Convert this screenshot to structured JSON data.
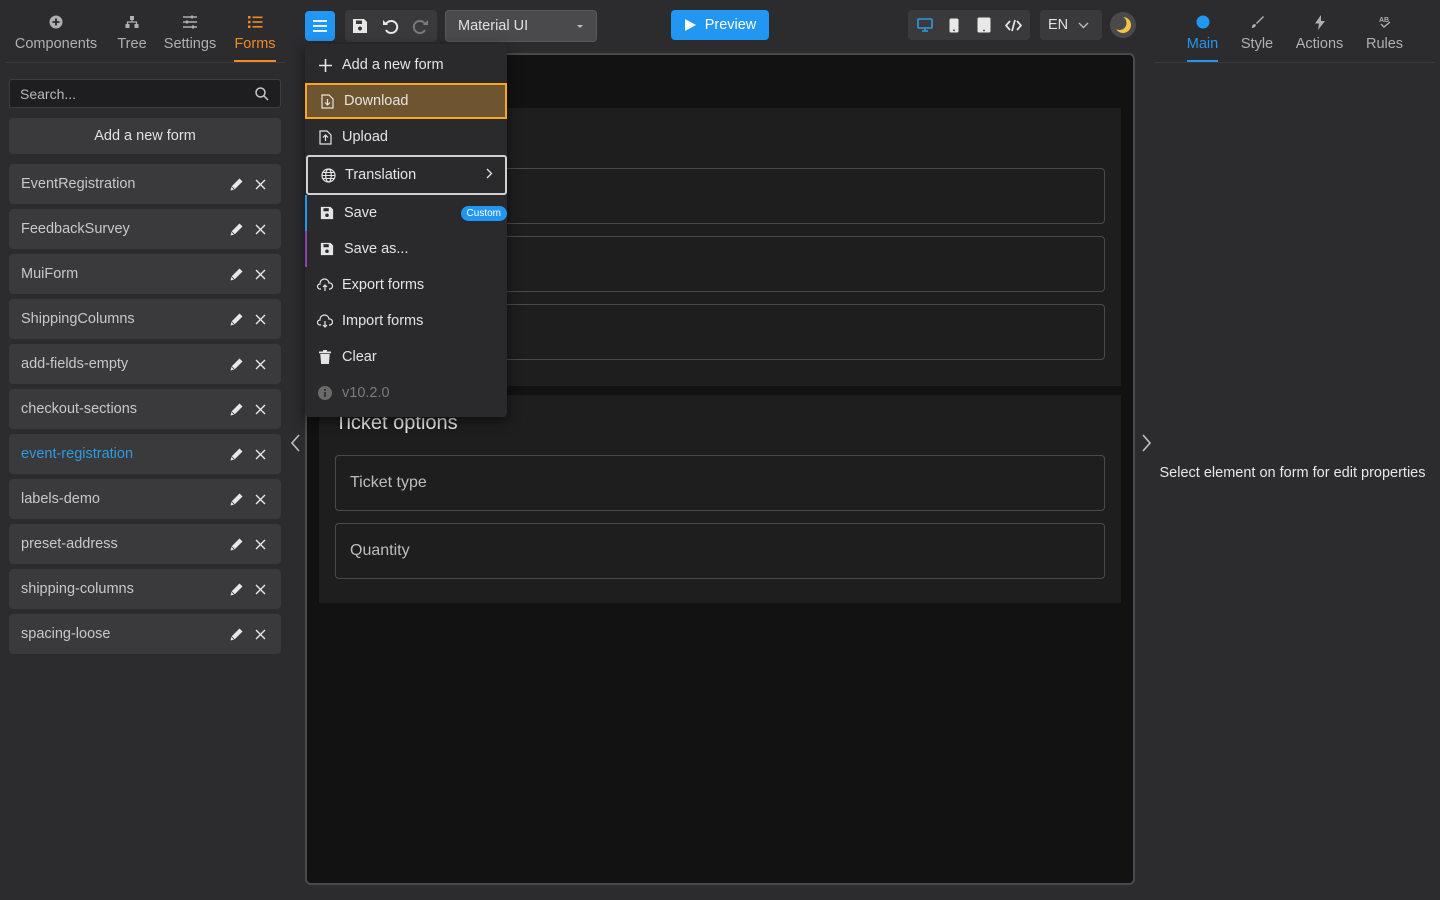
{
  "left_tabs": [
    {
      "label": "Components",
      "icon": "plus-circle-icon"
    },
    {
      "label": "Tree",
      "icon": "tree-icon"
    },
    {
      "label": "Settings",
      "icon": "sliders-icon"
    },
    {
      "label": "Forms",
      "icon": "list-icon",
      "active": true
    }
  ],
  "search": {
    "placeholder": "Search..."
  },
  "add_form_label": "Add a new form",
  "forms": [
    "EventRegistration",
    "FeedbackSurvey",
    "MuiForm",
    "ShippingColumns",
    "add-fields-empty",
    "checkout-sections",
    "event-registration",
    "labels-demo",
    "preset-address",
    "shipping-columns",
    "spacing-loose"
  ],
  "active_form": "event-registration",
  "toolbar": {
    "theme_value": "Material UI",
    "preview_label": "Preview",
    "language": "EN"
  },
  "menu": {
    "add_new_form": "Add a new form",
    "download": "Download",
    "upload": "Upload",
    "translation": "Translation",
    "save": "Save",
    "save_badge": "Custom",
    "save_as": "Save as...",
    "export_forms": "Export forms",
    "import_forms": "Import forms",
    "clear": "Clear",
    "version": "v10.2.0"
  },
  "canvas": {
    "section_b_title": "Ticket options",
    "fields_b": [
      "Ticket type",
      "Quantity"
    ]
  },
  "right_tabs": [
    {
      "label": "Main",
      "icon": "dot-icon",
      "active": true
    },
    {
      "label": "Style",
      "icon": "brush-icon"
    },
    {
      "label": "Actions",
      "icon": "bolt-icon"
    },
    {
      "label": "Rules",
      "icon": "ab-icon"
    }
  ],
  "right_message": "Select element on form for edit properties",
  "colors": {
    "accent_orange": "#f08a24",
    "accent_blue": "#2196f3",
    "background": "#2c2c2e",
    "canvas": "#121212"
  }
}
